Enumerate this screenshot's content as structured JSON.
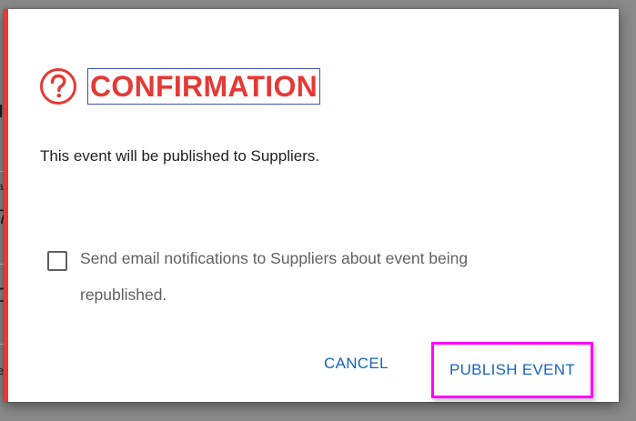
{
  "dialog": {
    "title": "CONFIRMATION",
    "message": "This event will be published to Suppliers.",
    "checkbox": {
      "checked": false,
      "label": "Send email notifications to Suppliers about event being republished."
    },
    "buttons": {
      "cancel_label": "CANCEL",
      "publish_label": "PUBLISH EVENT"
    },
    "icon": "question-circle-icon"
  },
  "background_fragments": {
    "frag_1": "a",
    "frag_2": "7",
    "frag_3": "C",
    "frag_4": "e"
  },
  "colors": {
    "accent_red": "#e53935",
    "button_blue": "#1565c0",
    "highlight_magenta": "#ff00ff",
    "title_outline_blue": "#3f51b5"
  }
}
